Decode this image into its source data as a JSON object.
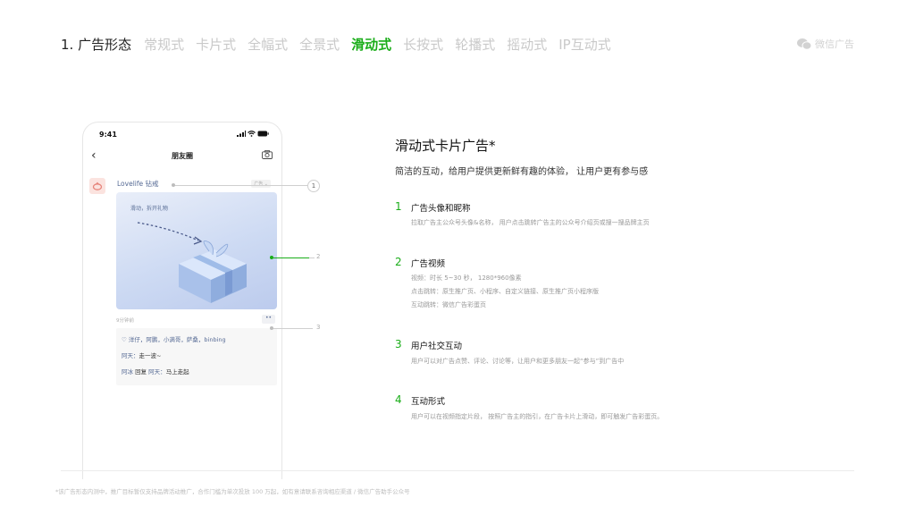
{
  "topnav": {
    "section": "1. 广告形态",
    "tabs": [
      {
        "label": "常规式",
        "active": false
      },
      {
        "label": "卡片式",
        "active": false
      },
      {
        "label": "全幅式",
        "active": false
      },
      {
        "label": "全景式",
        "active": false
      },
      {
        "label": "滑动式",
        "active": true
      },
      {
        "label": "长按式",
        "active": false
      },
      {
        "label": "轮播式",
        "active": false
      },
      {
        "label": "摇动式",
        "active": false
      },
      {
        "label": "IP互动式",
        "active": false
      }
    ],
    "brand": "微信广告"
  },
  "phone": {
    "time": "9:41",
    "nav_title": "朋友圈",
    "post_name": "Lovelife 钻戒",
    "ad_badge": "广告 ⌄",
    "card_hint": "滑动，拆开礼物",
    "post_time": "9分钟前",
    "more": "••",
    "likes": "♡ 洋仔，阿鹏，小满哥，萨桑，binbing",
    "comment1_name": "阿天：",
    "comment1_text": "走一波~",
    "comment2_name": "阿冰",
    "comment2_mid": " 回复 ",
    "comment2_name2": "阿天：",
    "comment2_text": "马上走起"
  },
  "callouts": [
    "1",
    "2",
    "3"
  ],
  "content": {
    "headline": "滑动式卡片广告*",
    "subhead": "简洁的互动，给用户提供更新鲜有趣的体验，  让用户更有参与感",
    "features": [
      {
        "num": "1",
        "title": "广告头像和昵称",
        "lines": [
          "拉取广告主公众号头像&名称，  用户点击跳转广告主的公众号介绍页或搜一搜品牌主页"
        ]
      },
      {
        "num": "2",
        "title": "广告视频",
        "lines": [
          "视频：时长 5~30 秒，  1280*960像素",
          "点击跳转：原生推广页、小程序、自定义链接、原生推广页小程序版",
          "互动跳转：微信广告彩蛋页"
        ]
      },
      {
        "num": "3",
        "title": "用户社交互动",
        "lines": [
          "用户可以对广告点赞、评论、讨论等，让用户和更多朋友一起“参与”到广告中"
        ]
      },
      {
        "num": "4",
        "title": "互动形式",
        "lines": [
          "用户可以在视频指定片段，  按照广告主的指引，在广告卡片上滑动，即可触发广告彩蛋页。"
        ]
      }
    ]
  },
  "footnote": "*该广告形态内测中，推广目标暂仅支持品牌活动推广，合作门槛为单次投放 100 万起，如有意请联系咨询相应渠道 / 微信广告助手公众号",
  "colors": {
    "accent": "#1aad19",
    "link": "#576b95",
    "muted": "#c9c9c9"
  }
}
